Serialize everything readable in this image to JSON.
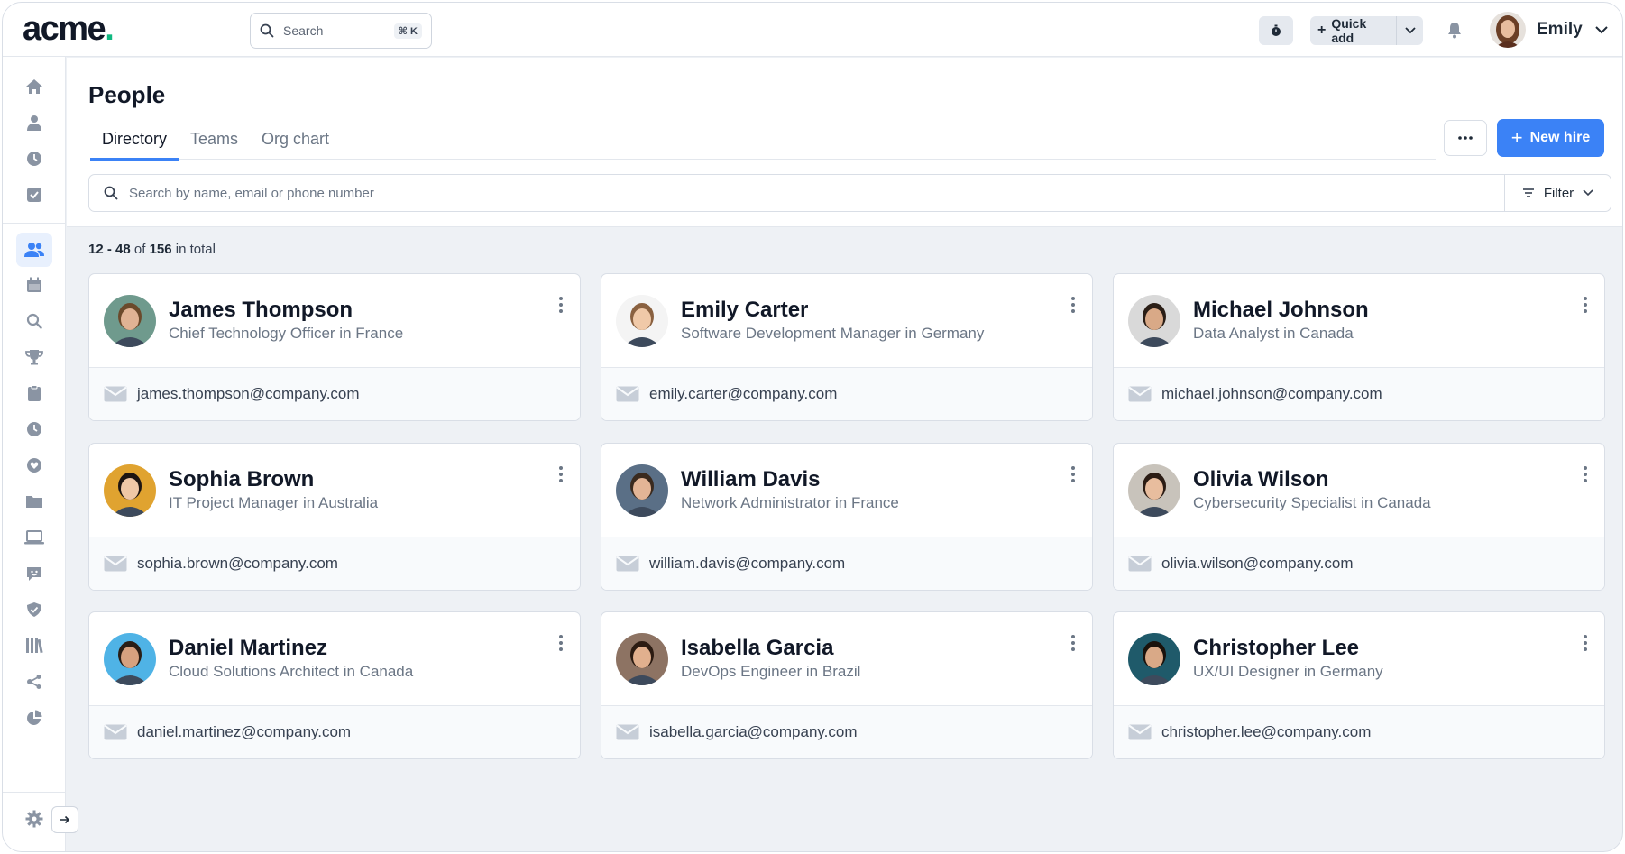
{
  "app": {
    "logo_text": "acme",
    "logo_dot": ".",
    "search_placeholder": "Search",
    "search_shortcut": "⌘ K",
    "quick_add_label": "Quick add",
    "user_name": "Emily"
  },
  "page": {
    "title": "People",
    "tabs": [
      {
        "label": "Directory",
        "active": true
      },
      {
        "label": "Teams",
        "active": false
      },
      {
        "label": "Org chart",
        "active": false
      }
    ],
    "more_label": "•••",
    "new_hire_label": "New hire",
    "search_placeholder": "Search by name, email or phone number",
    "filter_label": "Filter"
  },
  "results": {
    "range": "12 - 48",
    "of_text": "of",
    "total": "156",
    "suffix": "in total"
  },
  "people": [
    {
      "name": "James Thompson",
      "title": "Chief Technology Officer in France",
      "email": "james.thompson@company.com",
      "avatar_bg": "#6f9a8d",
      "skin": "#e0b394",
      "hair": "#6b4a2b"
    },
    {
      "name": "Emily Carter",
      "title": "Software Development Manager in Germany",
      "email": "emily.carter@company.com",
      "avatar_bg": "#f4f4f4",
      "skin": "#f0c9a8",
      "hair": "#8a6140"
    },
    {
      "name": "Michael Johnson",
      "title": "Data Analyst in Canada",
      "email": "michael.johnson@company.com",
      "avatar_bg": "#d9d9d9",
      "skin": "#d9a987",
      "hair": "#2a1e16"
    },
    {
      "name": "Sophia Brown",
      "title": "IT Project Manager in Australia",
      "email": "sophia.brown@company.com",
      "avatar_bg": "#e0a330",
      "skin": "#efc7a6",
      "hair": "#1d1512"
    },
    {
      "name": "William Davis",
      "title": "Network Administrator in France",
      "email": "william.davis@company.com",
      "avatar_bg": "#5a6f86",
      "skin": "#e3b596",
      "hair": "#3a2a1e"
    },
    {
      "name": "Olivia Wilson",
      "title": "Cybersecurity Specialist in Canada",
      "email": "olivia.wilson@company.com",
      "avatar_bg": "#c8c3bb",
      "skin": "#e8bd9e",
      "hair": "#2b1c14"
    },
    {
      "name": "Daniel Martinez",
      "title": "Cloud Solutions Architect in Canada",
      "email": "daniel.martinez@company.com",
      "avatar_bg": "#4fb3e6",
      "skin": "#d6a17f",
      "hair": "#2a1e16"
    },
    {
      "name": "Isabella Garcia",
      "title": "DevOps Engineer in Brazil",
      "email": "isabella.garcia@company.com",
      "avatar_bg": "#8d7363",
      "skin": "#e1b08e",
      "hair": "#2b1b12"
    },
    {
      "name": "Christopher Lee",
      "title": "UX/UI Designer in Germany",
      "email": "christopher.lee@company.com",
      "avatar_bg": "#1f5a6a",
      "skin": "#d9a987",
      "hair": "#1a120c"
    }
  ],
  "colors": {
    "accent": "#3b82f6",
    "logo_dot": "#10b981",
    "icon_gray": "#8a94a3"
  },
  "sidebar_icons": [
    "home-icon",
    "user-icon",
    "clock-icon",
    "check-square-icon",
    "users-icon",
    "calendar-icon",
    "search-icon",
    "trophy-icon",
    "clipboard-icon",
    "time-icon",
    "heart-icon",
    "folder-icon",
    "laptop-icon",
    "chat-icon",
    "shield-icon",
    "library-icon",
    "share-icon",
    "pie-chart-icon",
    "gear-icon",
    "arrow-right-icon"
  ]
}
